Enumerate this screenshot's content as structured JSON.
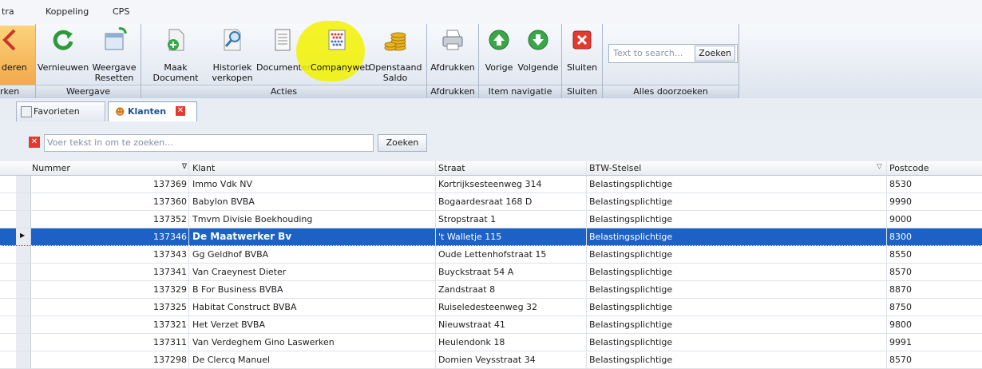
{
  "menu": [
    "tra",
    "Koppeling",
    "CPS"
  ],
  "ribbon": {
    "groups": [
      {
        "caption": "rken",
        "buttons": [
          {
            "label": "deren",
            "icon": "back-arrow-icon"
          }
        ]
      },
      {
        "caption": "Weergave",
        "buttons": [
          {
            "label": "Vernieuwen",
            "icon": "refresh-icon"
          },
          {
            "label": "Weergave Resetten",
            "icon": "reset-view-icon"
          }
        ]
      },
      {
        "caption": "Acties",
        "buttons": [
          {
            "label": "Maak Document",
            "sub": "▾",
            "icon": "new-document-icon"
          },
          {
            "label": "Historiek verkopen",
            "icon": "search-history-icon"
          },
          {
            "label": "Documenten",
            "icon": "documents-icon"
          },
          {
            "label": "Companyweb",
            "icon": "companyweb-icon"
          },
          {
            "label": "Openstaand Saldo",
            "icon": "coins-icon"
          }
        ]
      },
      {
        "caption": "Afdrukken",
        "buttons": [
          {
            "label": "Afdrukken",
            "icon": "printer-icon"
          }
        ]
      },
      {
        "caption": "Item navigatie",
        "buttons": [
          {
            "label": "Vorige",
            "icon": "up-arrow-icon"
          },
          {
            "label": "Volgende",
            "icon": "down-arrow-icon"
          }
        ]
      },
      {
        "caption": "Sluiten",
        "buttons": [
          {
            "label": "Sluiten",
            "icon": "close-icon"
          }
        ]
      },
      {
        "caption": "Alles doorzoeken",
        "search_placeholder": "Text to search...",
        "search_button": "Zoeken"
      }
    ]
  },
  "tabs": [
    {
      "label": "Favorieten",
      "icon": "favorites-icon"
    },
    {
      "label": "Klanten",
      "icon": "customers-icon",
      "close": "close-tab-icon"
    }
  ],
  "filter": {
    "placeholder": "Voer tekst in om te zoeken...",
    "button": "Zoeken",
    "clear_icon": "clear-icon"
  },
  "table": {
    "columns": [
      "Nummer",
      "Klant",
      "Straat",
      "BTW-Stelsel",
      "Postcode"
    ],
    "rows": [
      [
        "137369",
        "Immo Vdk NV",
        "Kortrijksesteenweg 314",
        "Belastingsplichtige",
        "8530"
      ],
      [
        "137360",
        "Babylon BVBA",
        "Bogaardesraat 168 D",
        "Belastingsplichtige",
        "9990"
      ],
      [
        "137352",
        "Tmvm Divisie Boekhouding",
        "Stropstraat 1",
        "Belastingsplichtige",
        "9000"
      ],
      [
        "137346",
        "De Maatwerker Bv",
        "'t Walletje 115",
        "Belastingsplichtige",
        "8300"
      ],
      [
        "137343",
        "Gg Geldhof BVBA",
        "Oude Lettenhofstraat 15",
        "Belastingsplichtige",
        "8550"
      ],
      [
        "137341",
        "Van Craeynest Dieter",
        "Buyckstraat 54 A",
        "Belastingsplichtige",
        "8570"
      ],
      [
        "137329",
        "B For Business BVBA",
        "Zandstraat 8",
        "Belastingsplichtige",
        "8870"
      ],
      [
        "137325",
        "Habitat Construct BVBA",
        "Ruiseledesteenweg 32",
        "Belastingsplichtige",
        "8750"
      ],
      [
        "137321",
        "Het Verzet BVBA",
        "Nieuwstraat 41",
        "Belastingsplichtige",
        "9800"
      ],
      [
        "137311",
        "Van Verdeghem Gino Laswerken",
        "Heulendonk 18",
        "Belastingsplichtige",
        "9991"
      ],
      [
        "137298",
        "De Clercq Manuel",
        "Domien Veysstraat 34",
        "Belastingsplichtige",
        "8570"
      ]
    ],
    "selected_row": 3
  },
  "colors": {
    "selection": "#1c62c6",
    "highlight": "#f2f200"
  }
}
